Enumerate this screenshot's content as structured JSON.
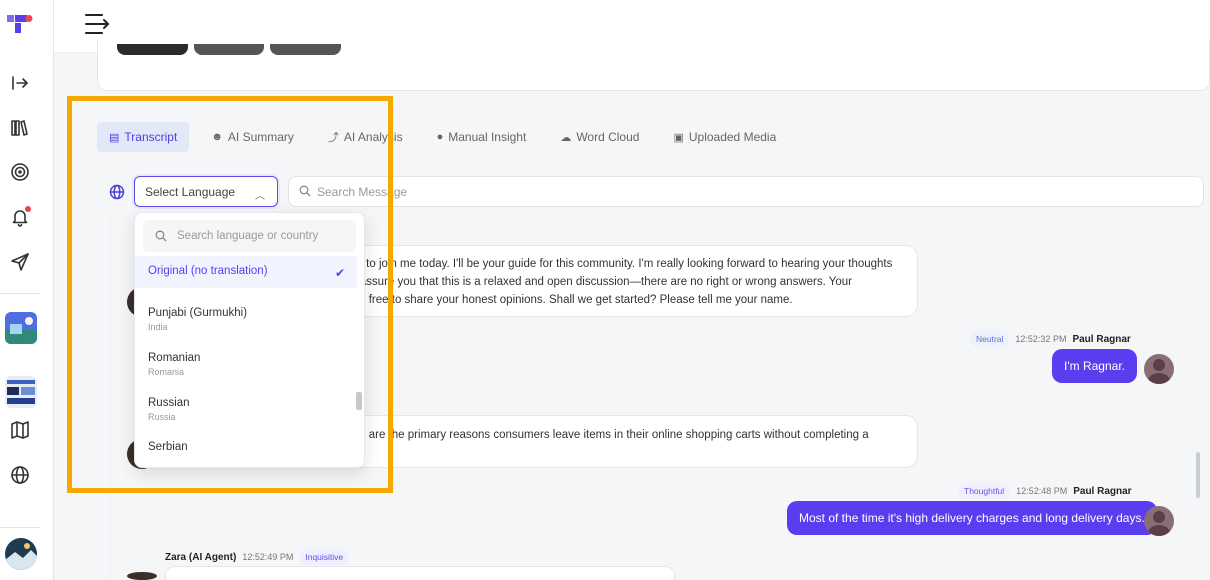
{
  "sidebar": {
    "items": [
      {
        "name": "login-arrow-icon"
      },
      {
        "name": "library-icon"
      },
      {
        "name": "target-icon"
      },
      {
        "name": "bell-icon",
        "has_notification": true
      },
      {
        "name": "send-icon"
      },
      {
        "name": "project-thumbnail-1"
      },
      {
        "name": "project-thumbnail-2"
      },
      {
        "name": "map-icon"
      },
      {
        "name": "globe-icon"
      },
      {
        "name": "user-avatar"
      }
    ]
  },
  "tabs": [
    {
      "label": "Transcript",
      "icon": "document-icon",
      "active": true
    },
    {
      "label": "AI Summary",
      "icon": "robot-icon"
    },
    {
      "label": "AI Analysis",
      "icon": "chart-icon"
    },
    {
      "label": "Manual Insight",
      "icon": "bulb-icon"
    },
    {
      "label": "Word Cloud",
      "icon": "cloud-icon"
    },
    {
      "label": "Uploaded Media",
      "icon": "media-icon"
    }
  ],
  "filters": {
    "language_select": "Select Language",
    "search_placeholder": "Search Message"
  },
  "dropdown": {
    "search_placeholder": "Search language or country",
    "items": [
      {
        "label": "Original (no translation)",
        "sub": "",
        "selected": true
      },
      {
        "label": "Punjabi (Gurmukhi)",
        "sub": "India"
      },
      {
        "label": "Romanian",
        "sub": "Romania"
      },
      {
        "label": "Russian",
        "sub": "Russia"
      },
      {
        "label": "Serbian",
        "sub": ""
      }
    ]
  },
  "messages": [
    {
      "side": "left",
      "text_lines": [
        "me to join me today. I'll be your guide for this community. I'm really looking forward to hearing your thoughts",
        "to assure you that this is a relaxed and open discussion—there are no right or wrong answers. Your",
        "feel free to share your honest opinions. Shall we get started? Please tell me your name."
      ]
    },
    {
      "side": "right",
      "tag": "Neutral",
      "time": "12:52:32 PM",
      "name": "Paul Ragnar",
      "text": "I'm Ragnar."
    },
    {
      "side": "left",
      "text_lines": [
        "eve are the primary reasons consumers leave items in their online shopping carts without completing a"
      ]
    },
    {
      "side": "right",
      "tag": "Thoughtful",
      "time": "12:52:48 PM",
      "name": "Paul Ragnar",
      "text": "Most of the time it's high delivery charges and long delivery days."
    },
    {
      "side": "left",
      "name": "Zara (AI Agent)",
      "time": "12:52:49 PM",
      "tag": "Inquisitive"
    }
  ],
  "colors": {
    "accent": "#5b3df0",
    "highlight": "#f5a800"
  }
}
